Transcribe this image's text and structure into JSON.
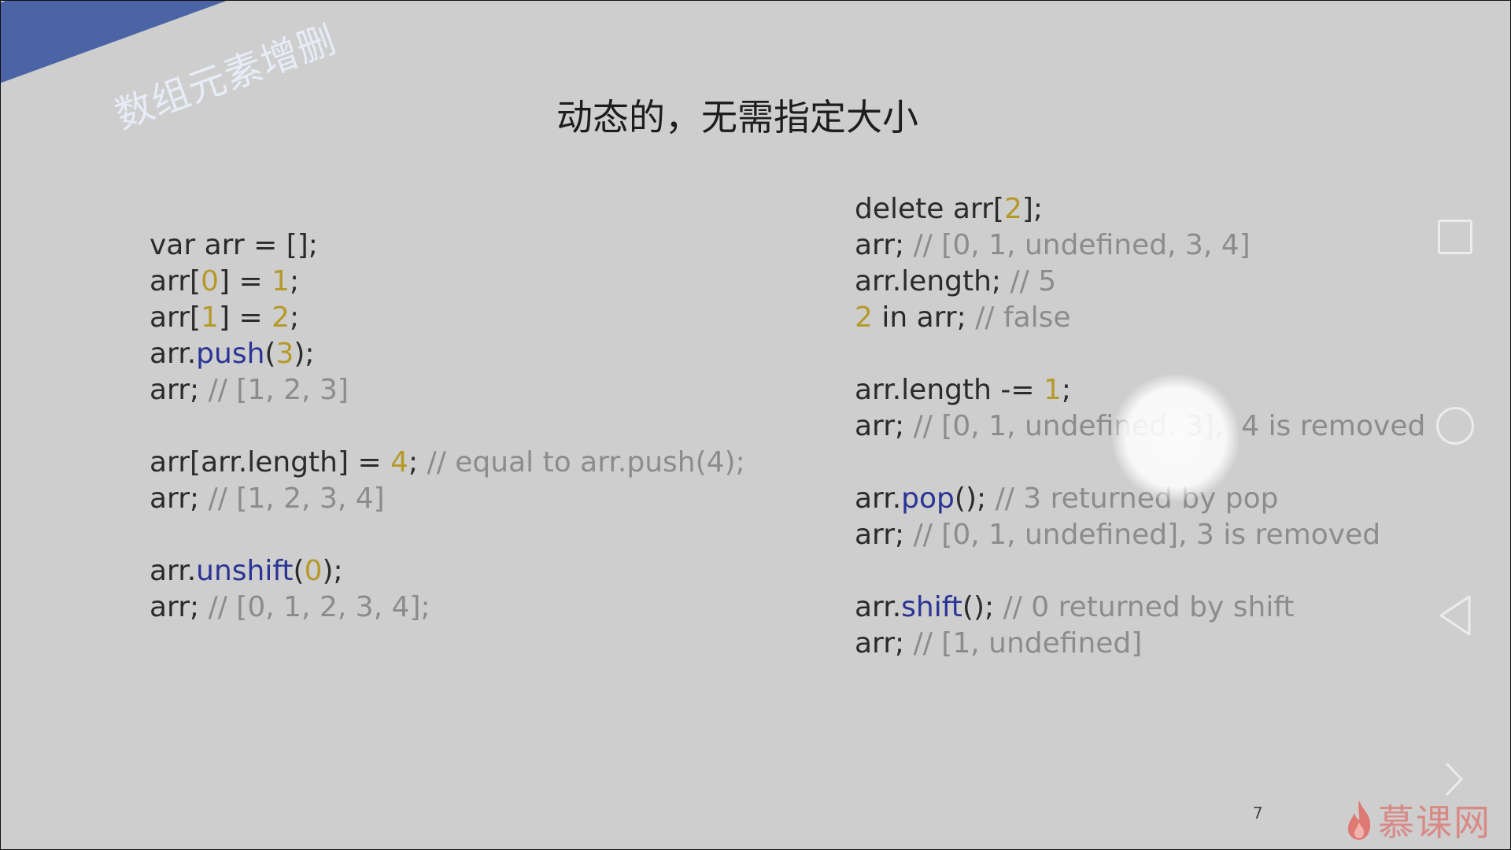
{
  "slide": {
    "ribbon_label": "数组元素增删",
    "title": "动态的，无需指定大小",
    "page_number": "7"
  },
  "left_code": [
    [
      {
        "t": "var arr = [];",
        "c": ""
      }
    ],
    [
      {
        "t": "arr[",
        "c": ""
      },
      {
        "t": "0",
        "c": "num"
      },
      {
        "t": "] = ",
        "c": ""
      },
      {
        "t": "1",
        "c": "num"
      },
      {
        "t": ";",
        "c": ""
      }
    ],
    [
      {
        "t": "arr[",
        "c": ""
      },
      {
        "t": "1",
        "c": "num"
      },
      {
        "t": "] = ",
        "c": ""
      },
      {
        "t": "2",
        "c": "num"
      },
      {
        "t": ";",
        "c": ""
      }
    ],
    [
      {
        "t": "arr.",
        "c": ""
      },
      {
        "t": "push",
        "c": "fn"
      },
      {
        "t": "(",
        "c": ""
      },
      {
        "t": "3",
        "c": "num"
      },
      {
        "t": ");",
        "c": ""
      }
    ],
    [
      {
        "t": "arr; ",
        "c": ""
      },
      {
        "t": "// [1, 2, 3]",
        "c": "cm"
      }
    ],
    [],
    [
      {
        "t": "arr[arr.length] = ",
        "c": ""
      },
      {
        "t": "4",
        "c": "num"
      },
      {
        "t": "; ",
        "c": ""
      },
      {
        "t": "// equal to arr.push(4);",
        "c": "cm"
      }
    ],
    [
      {
        "t": "arr; ",
        "c": ""
      },
      {
        "t": "// [1, 2, 3, 4]",
        "c": "cm"
      }
    ],
    [],
    [
      {
        "t": "arr.",
        "c": ""
      },
      {
        "t": "unshift",
        "c": "fn"
      },
      {
        "t": "(",
        "c": ""
      },
      {
        "t": "0",
        "c": "num"
      },
      {
        "t": ");",
        "c": ""
      }
    ],
    [
      {
        "t": "arr; ",
        "c": ""
      },
      {
        "t": "// [0, 1, 2, 3, 4];",
        "c": "cm"
      }
    ]
  ],
  "right_code": [
    [
      {
        "t": "delete arr[",
        "c": ""
      },
      {
        "t": "2",
        "c": "num"
      },
      {
        "t": "];",
        "c": ""
      }
    ],
    [
      {
        "t": "arr; ",
        "c": ""
      },
      {
        "t": "// [0, 1, undefined, 3, 4]",
        "c": "cm"
      }
    ],
    [
      {
        "t": "arr.length; ",
        "c": ""
      },
      {
        "t": "// 5",
        "c": "cm"
      }
    ],
    [
      {
        "t": "2",
        "c": "num"
      },
      {
        "t": " in arr; ",
        "c": ""
      },
      {
        "t": "// false",
        "c": "cm"
      }
    ],
    [],
    [
      {
        "t": "arr.length -= ",
        "c": ""
      },
      {
        "t": "1",
        "c": "num"
      },
      {
        "t": ";",
        "c": ""
      }
    ],
    [
      {
        "t": "arr; ",
        "c": ""
      },
      {
        "t": "// [0, 1, undefined, 3],  4 is removed",
        "c": "cm"
      }
    ],
    [],
    [
      {
        "t": "arr.",
        "c": ""
      },
      {
        "t": "pop",
        "c": "fn"
      },
      {
        "t": "(); ",
        "c": ""
      },
      {
        "t": "// 3 returned by pop",
        "c": "cm"
      }
    ],
    [
      {
        "t": "arr; ",
        "c": ""
      },
      {
        "t": "// [0, 1, undefined], 3 is removed",
        "c": "cm"
      }
    ],
    [],
    [
      {
        "t": "arr.",
        "c": ""
      },
      {
        "t": "shift",
        "c": "fn"
      },
      {
        "t": "(); ",
        "c": ""
      },
      {
        "t": "// 0 returned by shift",
        "c": "cm"
      }
    ],
    [
      {
        "t": "arr; ",
        "c": ""
      },
      {
        "t": "// [1, undefined]",
        "c": "cm"
      }
    ]
  ],
  "controls": {
    "square_icon": "recent-apps-icon",
    "circle_icon": "home-icon",
    "back_icon": "back-triangle-icon",
    "next_icon": "chevron-right-icon"
  },
  "logo": {
    "text": "慕课网",
    "color": "#d88a86"
  },
  "colors": {
    "background": "#cecece",
    "ribbon": "#4b64a6",
    "number": "#b59a2a",
    "function": "#2a3495",
    "comment": "#8c8c8c"
  }
}
